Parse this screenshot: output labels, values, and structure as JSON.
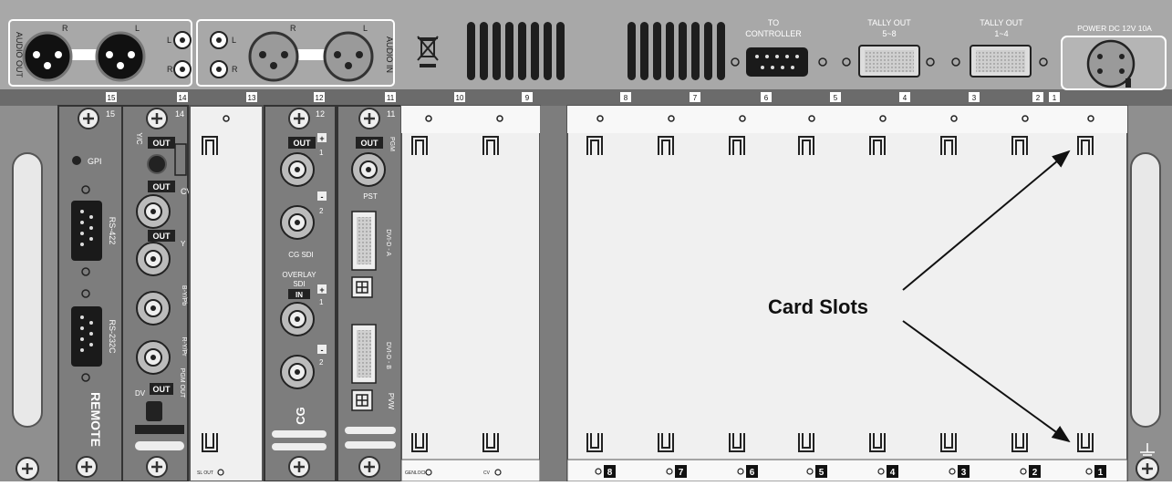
{
  "top_panel": {
    "audio_out_label": "AUDIO OUT",
    "audio_in_label": "AUDIO IN",
    "r": "R",
    "l": "L",
    "to_controller": [
      "TO",
      "CONTROLLER"
    ],
    "tally_out_58": [
      "TALLY OUT",
      "5~8"
    ],
    "tally_out_14": [
      "TALLY OUT",
      "1~4"
    ],
    "power": "POWER DC 12V 10A",
    "slot_numbers": [
      "15",
      "14",
      "13",
      "12",
      "11",
      "10",
      "9",
      "8",
      "7",
      "6",
      "5",
      "4",
      "3",
      "2",
      "1"
    ]
  },
  "cards": {
    "remote": {
      "gpi": "GPI",
      "rs422": "RS-422",
      "rs232": "RS-232C",
      "name": "REMOTE",
      "slot": "15"
    },
    "video": {
      "slot": "14",
      "out": "OUT",
      "yc": "Y/C",
      "cv": "CV",
      "y": "Y",
      "byr": "B-Y/Pb",
      "ryr": "R-Y/Pr",
      "dv": "DV",
      "pgm_out": "PGM OUT"
    },
    "cg": {
      "slot": "12",
      "out": "OUT",
      "plus": "+",
      "minus": "-",
      "one": "1",
      "two": "2",
      "cg_sdi": "CG SDI",
      "overlay": [
        "OVERLAY",
        "SDI"
      ],
      "in": "IN",
      "name": "CG"
    },
    "pvw": {
      "slot": "11",
      "out": "OUT",
      "pgm": "PGM",
      "pst": "PST",
      "dvi_a": "DVI-D - A",
      "dvi_b": "DVI-D - B",
      "pvw": "PVW"
    }
  },
  "bottom_labels": {
    "slot13": "SL OUT",
    "genlock": "GENLOCK",
    "cv": "CV",
    "card_numbers": [
      "8",
      "7",
      "6",
      "5",
      "4",
      "3",
      "2",
      "1"
    ]
  },
  "annotation": "Card Slots"
}
